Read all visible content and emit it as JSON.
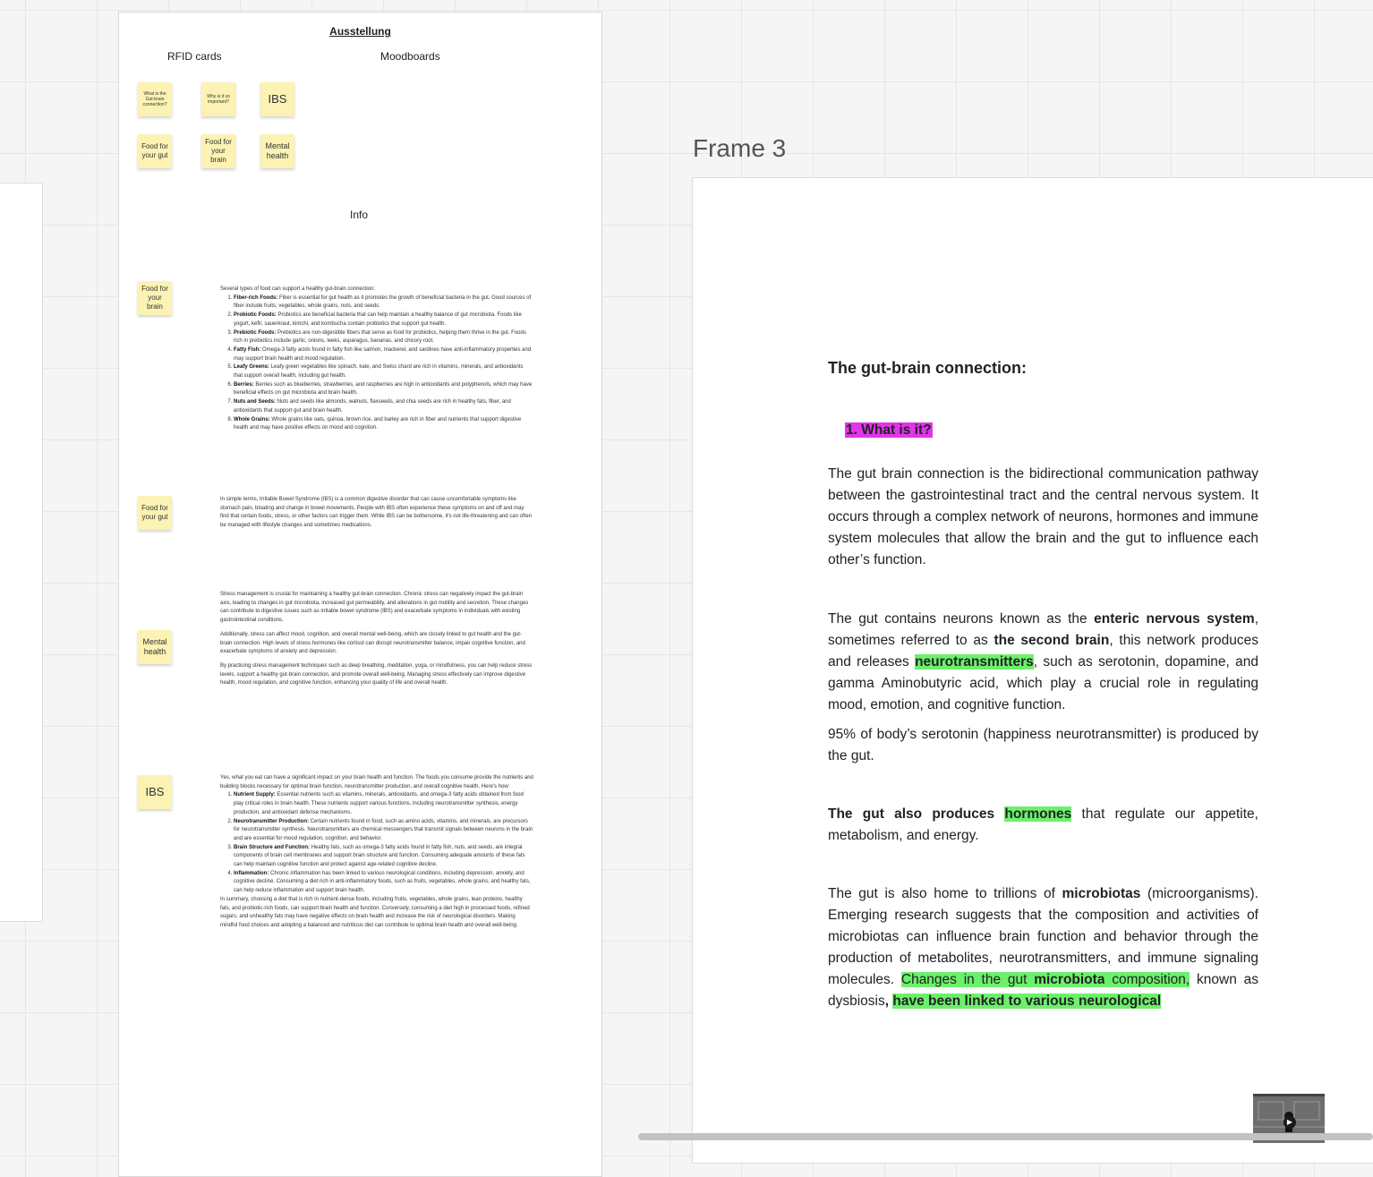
{
  "board": {
    "title": "Ausstellung",
    "rfid_label": "RFID cards",
    "moodboards_label": "Moodboards",
    "info_label": "Info",
    "rfid_cards": [
      "What is the Gut-brain connection?",
      "Why is it so important?",
      "IBS",
      "Food for your gut",
      "Food for your brain",
      "Mental health"
    ],
    "info_stickies": [
      "Food for your brain",
      "Food for your gut",
      "Mental health",
      "IBS"
    ],
    "gut_foods": {
      "intro": "Several types of food can support a healthy gut-brain connection:",
      "items": [
        {
          "title": "Fiber-rich Foods:",
          "text": "Fiber is essential for gut health as it promotes the growth of beneficial bacteria in the gut. Good sources of fiber include fruits, vegetables, whole grains, nuts, and seeds."
        },
        {
          "title": "Probiotic Foods:",
          "text": "Probiotics are beneficial bacteria that can help maintain a healthy balance of gut microbiota. Foods like yogurt, kefir, sauerkraut, kimchi, and kombucha contain probiotics that support gut health."
        },
        {
          "title": "Prebiotic Foods:",
          "text": "Prebiotics are non-digestible fibers that serve as food for probiotics, helping them thrive in the gut. Foods rich in prebiotics include garlic, onions, leeks, asparagus, bananas, and chicory root."
        },
        {
          "title": "Fatty Fish:",
          "text": "Omega-3 fatty acids found in fatty fish like salmon, mackerel, and sardines have anti-inflammatory properties and may support brain health and mood regulation."
        },
        {
          "title": "Leafy Greens:",
          "text": "Leafy green vegetables like spinach, kale, and Swiss chard are rich in vitamins, minerals, and antioxidants that support overall health, including gut health."
        },
        {
          "title": "Berries:",
          "text": "Berries such as blueberries, strawberries, and raspberries are high in antioxidants and polyphenols, which may have beneficial effects on gut microbiota and brain health."
        },
        {
          "title": "Nuts and Seeds:",
          "text": "Nuts and seeds like almonds, walnuts, flaxseeds, and chia seeds are rich in healthy fats, fiber, and antioxidants that support gut and brain health."
        },
        {
          "title": "Whole Grains:",
          "text": "Whole grains like oats, quinoa, brown rice, and barley are rich in fiber and nutrients that support digestive health and may have positive effects on mood and cognition."
        }
      ]
    },
    "ibs_text": "In simple terms, Irritable Bowel Syndrome (IBS) is a common digestive disorder that can cause uncomfortable symptoms like stomach pain, bloating and change in bowel movements. People with IBS often experience these symptoms on and off and may find that certain foods, stress, or other factors can trigger them. While IBS can be bothersome, it's not life-threatening and can often be managed with lifestyle changes and sometimes medications.",
    "mental": [
      "Stress management is crucial for maintaining a healthy gut-brain connection. Chronic stress can negatively impact the gut-brain axis, leading to changes in gut microbiota, increased gut permeability, and alterations in gut motility and secretion. These changes can contribute to digestive issues such as irritable bowel syndrome (IBS) and exacerbate symptoms in individuals with existing gastrointestinal conditions.",
      "Additionally, stress can affect mood, cognition, and overall mental well-being, which are closely linked to gut health and the gut-brain connection. High levels of stress hormones like cortisol can disrupt neurotransmitter balance, impair cognitive function, and exacerbate symptoms of anxiety and depression.",
      "By practicing stress management techniques such as deep breathing, meditation, yoga, or mindfulness, you can help reduce stress levels, support a healthy gut-brain connection, and promote overall well-being. Managing stress effectively can improve digestive health, mood regulation, and cognitive function, enhancing your quality of life and overall health."
    ],
    "brain": {
      "intro": "Yes, what you eat can have a significant impact on your brain health and function. The foods you consume provide the nutrients and building blocks necessary for optimal brain function, neurotransmitter production, and overall cognitive health. Here's how:",
      "items": [
        {
          "title": "Nutrient Supply:",
          "text": "Essential nutrients such as vitamins, minerals, antioxidants, and omega-3 fatty acids obtained from food play critical roles in brain health. These nutrients support various functions, including neurotransmitter synthesis, energy production, and antioxidant defense mechanisms."
        },
        {
          "title": "Neurotransmitter Production:",
          "text": "Certain nutrients found in food, such as amino acids, vitamins, and minerals, are precursors for neurotransmitter synthesis. Neurotransmitters are chemical messengers that transmit signals between neurons in the brain and are essential for mood regulation, cognition, and behavior."
        },
        {
          "title": "Brain Structure and Function:",
          "text": "Healthy fats, such as omega-3 fatty acids found in fatty fish, nuts, and seeds, are integral components of brain cell membranes and support brain structure and function. Consuming adequate amounts of these fats can help maintain cognitive function and protect against age-related cognitive decline."
        },
        {
          "title": "Inflammation:",
          "text": "Chronic inflammation has been linked to various neurological conditions, including depression, anxiety, and cognitive decline. Consuming a diet rich in anti-inflammatory foods, such as fruits, vegetables, whole grains, and healthy fats, can help reduce inflammation and support brain health."
        }
      ],
      "summary": "In summary, choosing a diet that is rich in nutrient-dense foods, including fruits, vegetables, whole grains, lean proteins, healthy fats, and probiotic-rich foods, can support brain health and function. Conversely, consuming a diet high in processed foods, refined sugars, and unhealthy fats may have negative effects on brain health and increase the risk of neurological disorders. Making mindful food choices and adopting a balanced and nutritious diet can contribute to optimal brain health and overall well-being."
    }
  },
  "frame3": {
    "label": "Frame 3",
    "heading": "The gut-brain connection:",
    "subheading": "1. What is it?",
    "p1": "The gut brain connection is the bidirectional communication pathway between the gastrointestinal tract and the central nervous system. It occurs through a complex network of neurons, hormones and immune system molecules that allow the brain and the gut to influence each other’s function.",
    "p2": {
      "a": "The gut contains neurons known as the ",
      "b": "enteric nervous system",
      "c": ", sometimes referred to as ",
      "d": "the second brain",
      "e": ", this network produces and releases ",
      "f": "neurotransmitters",
      "g": ", such as serotonin, dopamine, and gamma Aminobutyric acid, which play a crucial role in regulating mood, emotion, and cognitive function."
    },
    "p3": "95% of body’s serotonin (happiness neurotransmitter) is produced by the gut.",
    "p4": {
      "a": "The gut also produces ",
      "b": "hormones",
      "c": " that regulate our appetite, metabolism, and energy."
    },
    "p5": {
      "a": "The gut is also home to trillions of ",
      "b": "microbiotas",
      "c": " (microorganisms). Emerging research suggests that the composition and activities of microbiotas can influence brain function and behavior through the production of metabolites, neurotransmitters, and immune signaling molecules. ",
      "d": "Changes in the gut ",
      "e": "microbiota",
      "f": " composition,",
      "g": " known as dysbiosis",
      "h": ", ",
      "i": "have been linked to various neurological"
    }
  },
  "colors": {
    "sticky": "#fbf2b3",
    "highlight_pink": "#e234ec",
    "highlight_green": "#6cf06c"
  }
}
